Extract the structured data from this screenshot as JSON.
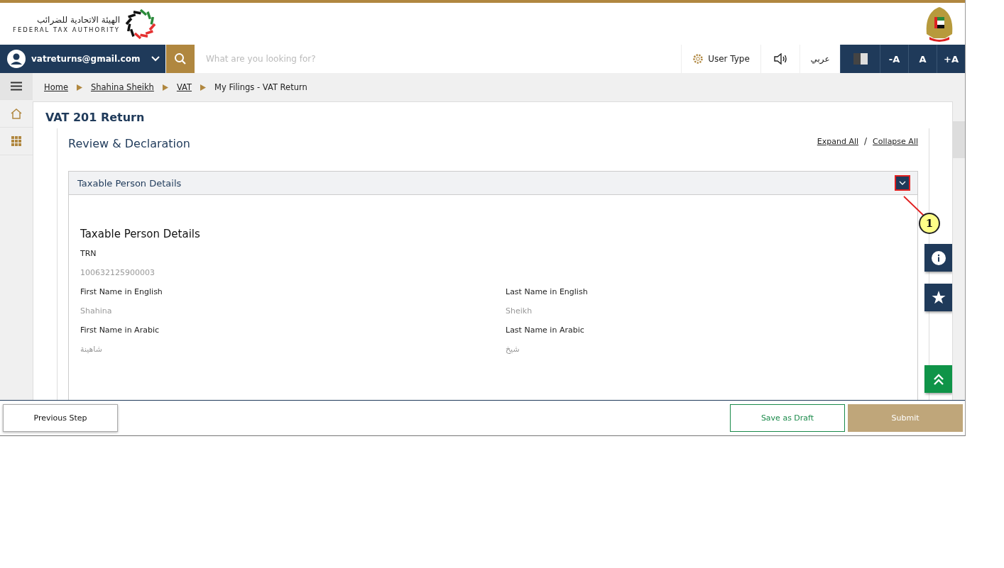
{
  "header": {
    "logo_arabic": "الهيئة الاتحادية للضرائب",
    "logo_english": "FEDERAL TAX AUTHORITY"
  },
  "nav": {
    "user": "vatreturns@gmail.com",
    "search_placeholder": "What are you looking for?",
    "user_type": "User Type",
    "language": "عربي",
    "font_buttons": [
      "-A",
      "A",
      "+A"
    ]
  },
  "breadcrumb": [
    {
      "label": "Home",
      "link": true
    },
    {
      "label": "Shahina Sheikh",
      "link": true
    },
    {
      "label": "VAT",
      "link": true
    },
    {
      "label": "My Filings - VAT Return",
      "link": false
    }
  ],
  "page_title": "VAT 201 Return",
  "section": {
    "title": "Review & Declaration",
    "expand_all": "Expand All",
    "separator": "/",
    "collapse_all": "Collapse All"
  },
  "accordion": {
    "title": "Taxable Person Details",
    "expanded": true,
    "body_title": "Taxable Person Details",
    "rows": [
      [
        {
          "label": "TRN",
          "value": "100632125900003"
        }
      ],
      [
        {
          "label": "First Name in English",
          "value": "Shahina"
        },
        {
          "label": "Last Name in English",
          "value": "Sheikh"
        }
      ],
      [
        {
          "label": "First Name in Arabic",
          "value": "شاهينة"
        },
        {
          "label": "Last Name in Arabic",
          "value": "شيخ"
        }
      ]
    ]
  },
  "callout": {
    "label": "1"
  },
  "footer": {
    "previous": "Previous Step",
    "save": {
      "label": "Save as Draft",
      "disabled": false
    },
    "submit": {
      "label": "Submit",
      "disabled": true
    }
  }
}
